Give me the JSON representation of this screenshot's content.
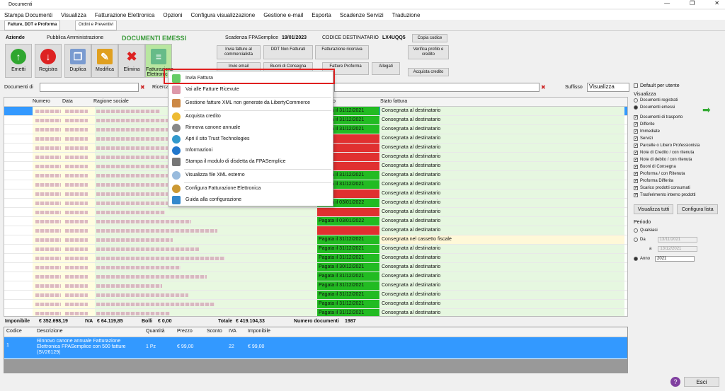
{
  "window": {
    "title": "Documenti",
    "min": "—",
    "max": "❐",
    "close": "✕"
  },
  "menu": [
    "Stampa Documenti",
    "Visualizza",
    "Fatturazione Elettronica",
    "Opzioni",
    "Configura visualizzazione",
    "Gestione e-mail",
    "Esporta",
    "Scadenze Servizi",
    "Traduzione"
  ],
  "tabs": {
    "t1": "Fatture, DDT e Proforma",
    "t2": "Ordini e Preventivi"
  },
  "subtabs": {
    "aziende": "Aziende",
    "pa": "Pubblica Amministrazione",
    "emessi": "DOCUMENTI EMESSI"
  },
  "scadenza": {
    "label": "Scadenza FPASemplice",
    "date": "19/01/2023",
    "cod_label": "CODICE DESTINATARIO",
    "cod": "LX4UQQ5",
    "copy": "Copia codice"
  },
  "toolbar": {
    "emetti": "Emetti",
    "registra": "Registra",
    "duplica": "Duplica",
    "modifica": "Modifica",
    "elimina": "Elimina",
    "fe": "Fatturazione Elettronica"
  },
  "small": {
    "invia": "Invia fatture al commercialista",
    "ddt": "DDT Non Fatturati",
    "ricorsiva": "Fatturazione ricorsiva",
    "verifica": "Verifica profilo e credito",
    "invio_email": "Invio email",
    "buoni": "Buoni di Consegna",
    "proforma": "Fatture Proforma",
    "allegati": "Allegati",
    "acquista": "Acquista credito"
  },
  "filter": {
    "doc_label": "Documenti di",
    "ricerca": "Ricerca",
    "suffisso": "Suffisso",
    "visualizza": "Visualizza"
  },
  "grid": {
    "cols": {
      "numero": "Numero",
      "data": "Data",
      "ragione": "Ragione sociale",
      "stato_pag": "o",
      "stato": "Stato fattura"
    },
    "rows": [
      [
        "Pagata il 31/12/2021",
        "Consegnata al destinatario",
        "g"
      ],
      [
        "Pagata il 31/12/2021",
        "Consegnata al destinatario",
        "g"
      ],
      [
        "Pagata il 31/12/2021",
        "Consegnata al destinatario",
        "g"
      ],
      [
        "",
        "Consegnata al destinatario",
        "r"
      ],
      [
        "",
        "Consegnata al destinatario",
        "r"
      ],
      [
        "",
        "Consegnata al destinatario",
        "r"
      ],
      [
        "",
        "Consegnata al destinatario",
        "r"
      ],
      [
        "Pagata il 31/12/2021",
        "Consegnata al destinatario",
        "g"
      ],
      [
        "Pagata il 31/12/2021",
        "Consegnata al destinatario",
        "g"
      ],
      [
        "",
        "Consegnata al destinatario",
        "r"
      ],
      [
        "Pagata il 03/01/2022",
        "Consegnata al destinatario",
        "g"
      ],
      [
        "",
        "Consegnata al destinatario",
        "r"
      ],
      [
        "Pagata il 03/01/2022",
        "Consegnata al destinatario",
        "g"
      ],
      [
        "",
        "Consegnata al destinatario",
        "r"
      ],
      [
        "Pagata il 31/12/2021",
        "Consegnata nel cassetto fiscale",
        "g"
      ],
      [
        "Pagata il 31/12/2021",
        "Consegnata al destinatario",
        "g"
      ],
      [
        "Pagata il 31/12/2021",
        "Consegnata al destinatario",
        "g"
      ],
      [
        "Pagata il 30/12/2021",
        "Consegnata al destinatario",
        "g"
      ],
      [
        "Pagata il 31/12/2021",
        "Consegnata al destinatario",
        "g"
      ],
      [
        "Pagata il 31/12/2021",
        "Consegnata al destinatario",
        "g"
      ],
      [
        "Pagata il 31/12/2021",
        "Consegnata al destinatario",
        "g"
      ],
      [
        "Pagata il 31/12/2021",
        "Consegnata al destinatario",
        "g"
      ],
      [
        "Pagata il 31/12/2021",
        "Consegnata al destinatario",
        "g"
      ],
      [
        "Pagata il 31/12/2021",
        "Consegnata al destinatario",
        "g"
      ]
    ]
  },
  "context_menu": [
    "Invia Fattura",
    "Vai alle Fatture Ricevute",
    "Gestione fatture XML non generate da LibertyCommerce",
    "Acquista credito",
    "Rinnova canone annuale",
    "Apri il sito Trust Technologies",
    "Informazioni",
    "Stampa il modulo di disdetta da FPASemplice",
    "Visualizza file XML esterno",
    "Configura Fatturazione Elettronica",
    "Guida alla configurazione"
  ],
  "panel": {
    "default": "Default per utente",
    "visualizza": "Visualizza",
    "r1": "Documenti registrati",
    "r2": "Documenti emessi",
    "checks": [
      "Documenti di trasporto",
      "Differite",
      "Immediate",
      "Servizi",
      "Parcelle o Libero Professionista",
      "Note di Credito / con ritenuta",
      "Note di debito / con ritenuta",
      "Buoni di Consegna",
      "Proforma / con Ritenuta",
      "Proforma Differita",
      "Scarico prodotti consumati",
      "Trasferimento interno prodotti"
    ],
    "vis_tutti": "Visualizza tutti",
    "conf_lista": "Configura lista",
    "periodo": "Periodo",
    "qualsiasi": "Qualsiasi",
    "da": "Da",
    "da_val": "13/11/2021",
    "a": "a",
    "a_val": "13/12/2021",
    "anno": "Anno",
    "anno_val": "2021"
  },
  "totals": {
    "imp_label": "Imponibile",
    "imp": "€ 352.698,19",
    "iva_label": "IVA",
    "iva": "€ 64.119,85",
    "bolli_label": "Bolli",
    "bolli": "€ 0,00",
    "tot_label": "Totale",
    "tot": "€ 419.104,33",
    "num_label": "Numero documenti",
    "num": "1987"
  },
  "detail": {
    "cols": [
      "Codice",
      "Descrizione",
      "Quantità",
      "Prezzo",
      "Sconto",
      "IVA",
      "Imponibile"
    ],
    "row": [
      "1",
      "Rinnovo canone annuale Fatturazione Elettronica FPASemplice con 500 fatture (SV26129)",
      "1 Pz",
      "€ 99,00",
      "",
      "22",
      "€ 99,00"
    ]
  },
  "esci": "Esci",
  "help": "?"
}
